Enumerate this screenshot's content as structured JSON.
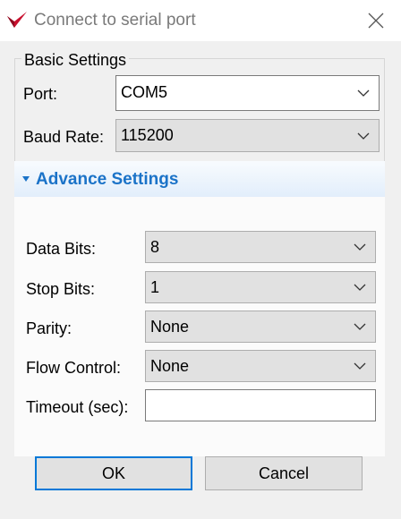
{
  "window": {
    "title": "Connect to serial port"
  },
  "basic_settings": {
    "legend": "Basic Settings",
    "port": {
      "label": "Port:",
      "value": "COM5"
    },
    "baud_rate": {
      "label": "Baud Rate:",
      "value": "115200"
    }
  },
  "advance_settings": {
    "title": "Advance Settings",
    "data_bits": {
      "label": "Data Bits:",
      "value": "8"
    },
    "stop_bits": {
      "label": "Stop Bits:",
      "value": "1"
    },
    "parity": {
      "label": "Parity:",
      "value": "None"
    },
    "flow_control": {
      "label": "Flow Control:",
      "value": "None"
    },
    "timeout": {
      "label": "Timeout (sec):",
      "value": ""
    }
  },
  "buttons": {
    "ok": "OK",
    "cancel": "Cancel"
  },
  "colors": {
    "accent": "#1b73c8",
    "default_button_border": "#0078d7",
    "app_icon": "#c8102e",
    "dialog_background": "#f0f0f0"
  },
  "icons": {
    "app": "red-checkmark-icon",
    "close": "close-x-icon",
    "dropdown": "chevron-down-icon",
    "expander": "triangle-down-icon"
  }
}
